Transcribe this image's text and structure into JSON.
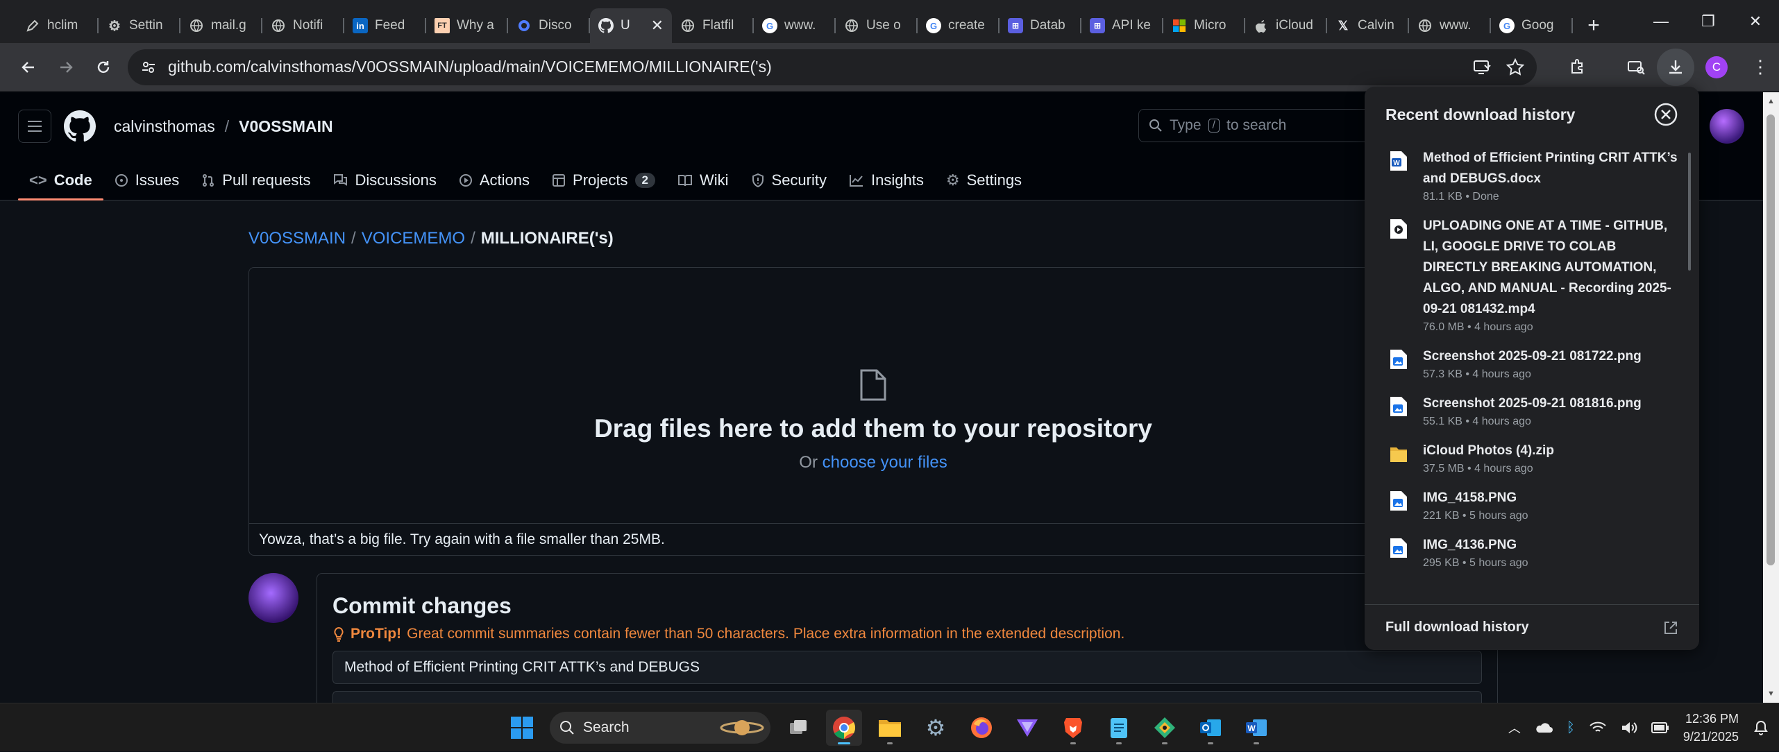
{
  "browser": {
    "tabs": [
      {
        "label": "hclim",
        "icon": "pen-icon"
      },
      {
        "label": "Settin",
        "icon": "gear-icon"
      },
      {
        "label": "mail.g",
        "icon": "globe-icon"
      },
      {
        "label": "Notifi",
        "icon": "globe-icon"
      },
      {
        "label": "Feed",
        "icon": "linkedin-icon"
      },
      {
        "label": "Why a",
        "icon": "ft-icon"
      },
      {
        "label": "Disco",
        "icon": "circle-icon"
      },
      {
        "label": "U",
        "icon": "github-icon",
        "active": true
      },
      {
        "label": "Flatfil",
        "icon": "globe-icon"
      },
      {
        "label": "www.",
        "icon": "google-icon"
      },
      {
        "label": "Use o",
        "icon": "globe-icon"
      },
      {
        "label": "create",
        "icon": "google-icon"
      },
      {
        "label": "Datab",
        "icon": "app-icon"
      },
      {
        "label": "API ke",
        "icon": "app-icon"
      },
      {
        "label": "Micro",
        "icon": "microsoft-icon"
      },
      {
        "label": "iCloud",
        "icon": "apple-icon"
      },
      {
        "label": "Calvin",
        "icon": "x-icon"
      },
      {
        "label": "www.",
        "icon": "globe-icon"
      },
      {
        "label": "Goog",
        "icon": "google-icon"
      }
    ],
    "url": "github.com/calvinsthomas/V0OSSMAIN/upload/main/VOICEMEMO/MILLIONAIRE('s)",
    "profile_initial": "C"
  },
  "github": {
    "owner": "calvinsthomas",
    "repo": "V0OSSMAIN",
    "search_prefix": "Type",
    "search_key": "/",
    "search_suffix": "to search",
    "nav": [
      {
        "label": "Code",
        "icon": "code-icon",
        "selected": true
      },
      {
        "label": "Issues",
        "icon": "issue-icon"
      },
      {
        "label": "Pull requests",
        "icon": "pull-request-icon"
      },
      {
        "label": "Discussions",
        "icon": "discussion-icon"
      },
      {
        "label": "Actions",
        "icon": "play-icon"
      },
      {
        "label": "Projects",
        "icon": "table-icon",
        "count": "2"
      },
      {
        "label": "Wiki",
        "icon": "book-icon"
      },
      {
        "label": "Security",
        "icon": "shield-icon"
      },
      {
        "label": "Insights",
        "icon": "graph-icon"
      },
      {
        "label": "Settings",
        "icon": "gear-icon"
      }
    ],
    "path": {
      "repo": "V0OSSMAIN",
      "folder": "VOICEMEMO",
      "current": "MILLIONAIRE('s)"
    },
    "dropzone": {
      "title": "Drag files here to add them to your repository",
      "sub_prefix": "Or",
      "sub_link": "choose your files",
      "error": "Yowza, that’s a big file. Try again with a file smaller than 25MB."
    },
    "commit": {
      "title": "Commit changes",
      "tip_label": "ProTip!",
      "tip_text": "Great commit summaries contain fewer than 50 characters. Place extra information in the extended description.",
      "summary_value": "Method of Efficient Printing CRIT ATTK’s and DEBUGS"
    }
  },
  "downloads": {
    "title": "Recent download history",
    "items": [
      {
        "name": "Method of Efficient Printing CRIT ATTK’s and DEBUGS.docx",
        "meta": "81.1 KB • Done",
        "type": "word"
      },
      {
        "name": "UPLOADING ONE AT A TIME - GITHUB, LI, GOOGLE DRIVE TO COLAB DIRECTLY BREAKING AUTOMATION, ALGO, AND MANUAL - Recording 2025-09-21 081432.mp4",
        "meta": "76.0 MB • 4 hours ago",
        "type": "video"
      },
      {
        "name": "Screenshot 2025-09-21 081722.png",
        "meta": "57.3 KB • 4 hours ago",
        "type": "image"
      },
      {
        "name": "Screenshot 2025-09-21 081816.png",
        "meta": "55.1 KB • 4 hours ago",
        "type": "image"
      },
      {
        "name": "iCloud Photos (4).zip",
        "meta": "37.5 MB • 4 hours ago",
        "type": "zip"
      },
      {
        "name": "IMG_4158.PNG",
        "meta": "221 KB • 5 hours ago",
        "type": "image"
      },
      {
        "name": "IMG_4136.PNG",
        "meta": "295 KB • 5 hours ago",
        "type": "image"
      }
    ],
    "footer": "Full download history"
  },
  "taskbar": {
    "search_label": "Search",
    "time": "12:36 PM",
    "date": "9/21/2025"
  },
  "colors": {
    "link": "#4493f8",
    "tip": "#f0883e",
    "selected_underline": "#fd8c73"
  }
}
